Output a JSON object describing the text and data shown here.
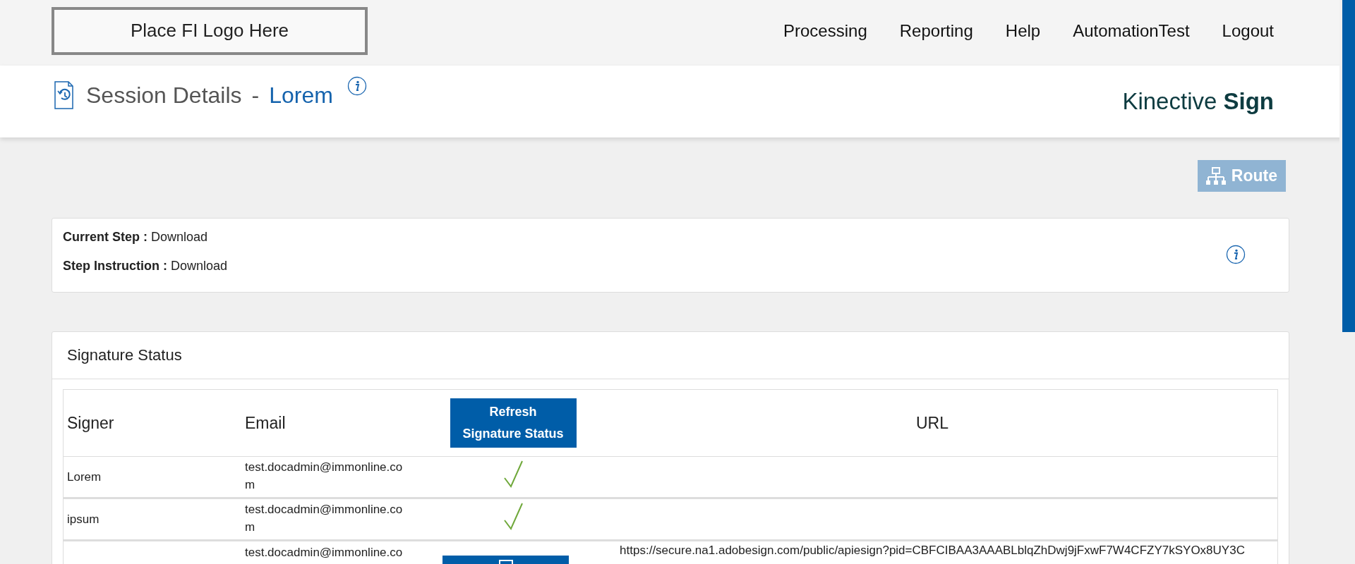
{
  "logo": {
    "text": "Place FI Logo Here"
  },
  "nav": [
    "Processing",
    "Reporting",
    "Help",
    "AutomationTest",
    "Logout"
  ],
  "page_title": {
    "title": "Session Details",
    "separator": "-",
    "session_name": "Lorem"
  },
  "brand": {
    "name": "Kinective",
    "emphasis": "Sign"
  },
  "route_button": {
    "label": "Route",
    "disabled": true
  },
  "step_info": [
    {
      "label": "Current Step :",
      "value": "Download"
    },
    {
      "label": "Step Instruction :",
      "value": "Download"
    }
  ],
  "signature_status": {
    "title": "Signature Status",
    "columns": [
      {
        "kind": "text",
        "label": "Signer"
      },
      {
        "kind": "text",
        "label": "Email"
      },
      {
        "kind": "button",
        "label": "Refresh Signature Status"
      },
      {
        "kind": "center",
        "label": "URL"
      }
    ],
    "rows": [
      {
        "signer": "Lorem",
        "email": "test.docadmin@immonline.com",
        "kind": "signed"
      },
      {
        "signer": "ipsum",
        "email": "test.docadmin@immonline.com",
        "kind": "signed"
      },
      {
        "email": "test.docadmin@immonline.co",
        "kind": "pending",
        "url": "https://secure.na1.adobesign.com/public/apiesign?pid=CBFCIBAA3AAABLblqZhDwj9jFxwF7W4CFZY7kSYOx8UY3C"
      }
    ]
  }
}
